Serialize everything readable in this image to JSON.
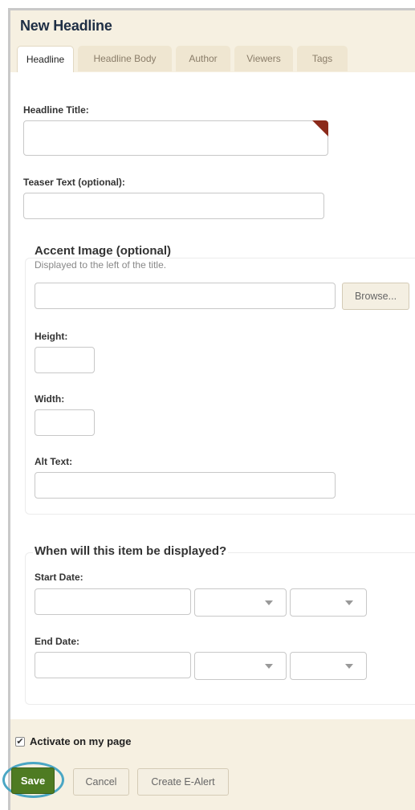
{
  "window": {
    "title": "New Headline"
  },
  "tabs": [
    {
      "label": "Headline"
    },
    {
      "label": "Headline Body"
    },
    {
      "label": "Author"
    },
    {
      "label": "Viewers"
    },
    {
      "label": "Tags"
    }
  ],
  "form": {
    "headline_title": {
      "label": "Headline Title:",
      "value": ""
    },
    "teaser_text": {
      "label": "Teaser Text (optional):",
      "value": ""
    },
    "accent_image": {
      "legend": "Accent Image (optional)",
      "help": "Displayed to the left of the title.",
      "file_value": "",
      "browse_label": "Browse...",
      "height_label": "Height:",
      "width_label": "Width:",
      "alt_text_label": "Alt Text:"
    },
    "display": {
      "legend": "When will this item be displayed?",
      "start_date_label": "Start Date:",
      "end_date_label": "End Date:"
    }
  },
  "footer": {
    "activate_label": "Activate on my page",
    "activate_checked": true,
    "save_label": "Save",
    "cancel_label": "Cancel",
    "create_ealert_label": "Create E-Alert"
  },
  "colors": {
    "accent_green": "#4e7b22",
    "highlight_ring": "#4aa6c4",
    "required_corner": "#8b2a1a",
    "panel_bg": "#f6f0e1"
  }
}
